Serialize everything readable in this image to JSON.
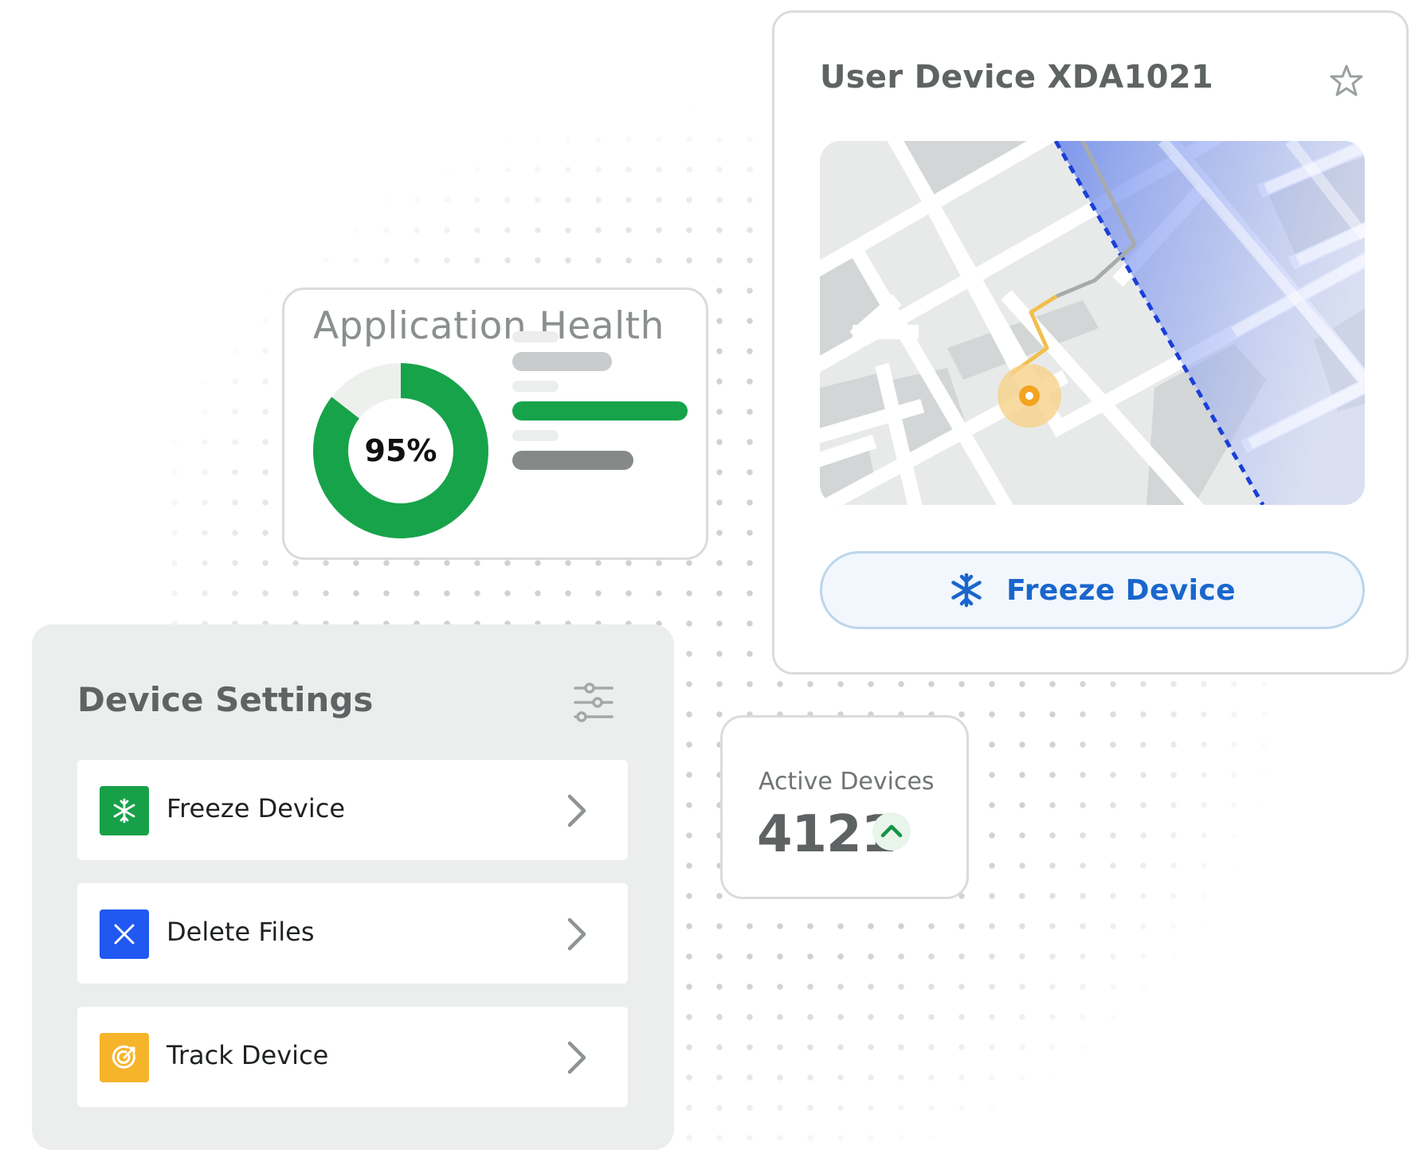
{
  "device_card": {
    "title": "User Device XDA1021",
    "action_label": "Freeze Device"
  },
  "health_card": {
    "title": "Application Health",
    "percent_label": "95%",
    "percent_value": 95
  },
  "active_card": {
    "label": "Active Devices",
    "value": "4121",
    "trend": "up"
  },
  "settings": {
    "title": "Device Settings",
    "items": [
      {
        "label": "Freeze Device",
        "icon": "snowflake-icon",
        "color": "#18a049"
      },
      {
        "label": "Delete Files",
        "icon": "close-icon",
        "color": "#2158f2"
      },
      {
        "label": "Track Device",
        "icon": "target-icon",
        "color": "#f6b42a"
      }
    ]
  },
  "colors": {
    "health_green": "#17a34a",
    "accent_blue": "#1a66cc",
    "route_orange": "#f0b43c",
    "zone_blue": "#1a3fd9"
  }
}
